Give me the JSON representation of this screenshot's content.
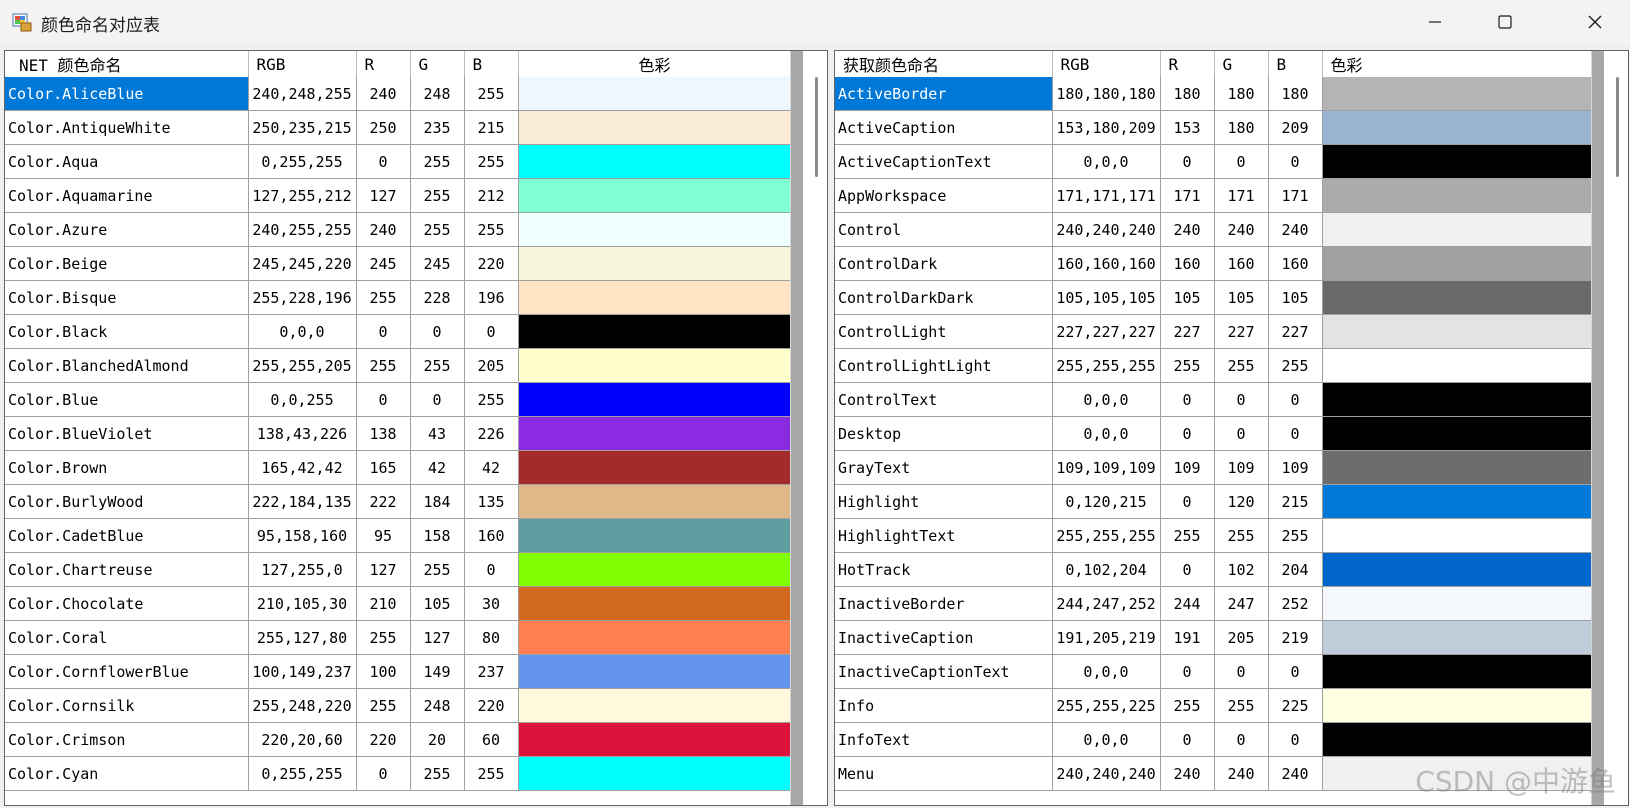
{
  "window": {
    "title": "颜色命名对应表",
    "watermark": "CSDN @中游鱼"
  },
  "left_grid": {
    "headers": [
      "NET 颜色命名",
      "RGB",
      "R",
      "G",
      "B",
      "色彩"
    ],
    "selected_row": 0,
    "rows": [
      {
        "name": "Color.AliceBlue",
        "rgb": "240,248,255",
        "r": "240",
        "g": "248",
        "b": "255",
        "color": "#f0f8ff"
      },
      {
        "name": "Color.AntiqueWhite",
        "rgb": "250,235,215",
        "r": "250",
        "g": "235",
        "b": "215",
        "color": "#faebd7"
      },
      {
        "name": "Color.Aqua",
        "rgb": "0,255,255",
        "r": "0",
        "g": "255",
        "b": "255",
        "color": "#00ffff"
      },
      {
        "name": "Color.Aquamarine",
        "rgb": "127,255,212",
        "r": "127",
        "g": "255",
        "b": "212",
        "color": "#7fffd4"
      },
      {
        "name": "Color.Azure",
        "rgb": "240,255,255",
        "r": "240",
        "g": "255",
        "b": "255",
        "color": "#f0ffff"
      },
      {
        "name": "Color.Beige",
        "rgb": "245,245,220",
        "r": "245",
        "g": "245",
        "b": "220",
        "color": "#f5f5dc"
      },
      {
        "name": "Color.Bisque",
        "rgb": "255,228,196",
        "r": "255",
        "g": "228",
        "b": "196",
        "color": "#ffe4c4"
      },
      {
        "name": "Color.Black",
        "rgb": "0,0,0",
        "r": "0",
        "g": "0",
        "b": "0",
        "color": "#000000"
      },
      {
        "name": "Color.BlanchedAlmond",
        "rgb": "255,255,205",
        "r": "255",
        "g": "255",
        "b": "205",
        "color": "#ffffcd"
      },
      {
        "name": "Color.Blue",
        "rgb": "0,0,255",
        "r": "0",
        "g": "0",
        "b": "255",
        "color": "#0000ff"
      },
      {
        "name": "Color.BlueViolet",
        "rgb": "138,43,226",
        "r": "138",
        "g": "43",
        "b": "226",
        "color": "#8a2be2"
      },
      {
        "name": "Color.Brown",
        "rgb": "165,42,42",
        "r": "165",
        "g": "42",
        "b": "42",
        "color": "#a52a2a"
      },
      {
        "name": "Color.BurlyWood",
        "rgb": "222,184,135",
        "r": "222",
        "g": "184",
        "b": "135",
        "color": "#deb887"
      },
      {
        "name": "Color.CadetBlue",
        "rgb": "95,158,160",
        "r": "95",
        "g": "158",
        "b": "160",
        "color": "#5f9ea0"
      },
      {
        "name": "Color.Chartreuse",
        "rgb": "127,255,0",
        "r": "127",
        "g": "255",
        "b": "0",
        "color": "#7fff00"
      },
      {
        "name": "Color.Chocolate",
        "rgb": "210,105,30",
        "r": "210",
        "g": "105",
        "b": "30",
        "color": "#d2691e"
      },
      {
        "name": "Color.Coral",
        "rgb": "255,127,80",
        "r": "255",
        "g": "127",
        "b": "80",
        "color": "#ff7f50"
      },
      {
        "name": "Color.CornflowerBlue",
        "rgb": "100,149,237",
        "r": "100",
        "g": "149",
        "b": "237",
        "color": "#6495ed"
      },
      {
        "name": "Color.Cornsilk",
        "rgb": "255,248,220",
        "r": "255",
        "g": "248",
        "b": "220",
        "color": "#fff8dc"
      },
      {
        "name": "Color.Crimson",
        "rgb": "220,20,60",
        "r": "220",
        "g": "20",
        "b": "60",
        "color": "#dc143c"
      },
      {
        "name": "Color.Cyan",
        "rgb": "0,255,255",
        "r": "0",
        "g": "255",
        "b": "255",
        "color": "#00ffff"
      }
    ]
  },
  "right_grid": {
    "headers": [
      "获取颜色命名",
      "RGB",
      "R",
      "G",
      "B",
      "色彩"
    ],
    "selected_row": 0,
    "rows": [
      {
        "name": "ActiveBorder",
        "rgb": "180,180,180",
        "r": "180",
        "g": "180",
        "b": "180",
        "color": "#b4b4b4"
      },
      {
        "name": "ActiveCaption",
        "rgb": "153,180,209",
        "r": "153",
        "g": "180",
        "b": "209",
        "color": "#99b4d1"
      },
      {
        "name": "ActiveCaptionText",
        "rgb": "0,0,0",
        "r": "0",
        "g": "0",
        "b": "0",
        "color": "#000000"
      },
      {
        "name": "AppWorkspace",
        "rgb": "171,171,171",
        "r": "171",
        "g": "171",
        "b": "171",
        "color": "#ababab"
      },
      {
        "name": "Control",
        "rgb": "240,240,240",
        "r": "240",
        "g": "240",
        "b": "240",
        "color": "#f0f0f0"
      },
      {
        "name": "ControlDark",
        "rgb": "160,160,160",
        "r": "160",
        "g": "160",
        "b": "160",
        "color": "#a0a0a0"
      },
      {
        "name": "ControlDarkDark",
        "rgb": "105,105,105",
        "r": "105",
        "g": "105",
        "b": "105",
        "color": "#696969"
      },
      {
        "name": "ControlLight",
        "rgb": "227,227,227",
        "r": "227",
        "g": "227",
        "b": "227",
        "color": "#e3e3e3"
      },
      {
        "name": "ControlLightLight",
        "rgb": "255,255,255",
        "r": "255",
        "g": "255",
        "b": "255",
        "color": "#ffffff"
      },
      {
        "name": "ControlText",
        "rgb": "0,0,0",
        "r": "0",
        "g": "0",
        "b": "0",
        "color": "#000000"
      },
      {
        "name": "Desktop",
        "rgb": "0,0,0",
        "r": "0",
        "g": "0",
        "b": "0",
        "color": "#000000"
      },
      {
        "name": "GrayText",
        "rgb": "109,109,109",
        "r": "109",
        "g": "109",
        "b": "109",
        "color": "#6d6d6d"
      },
      {
        "name": "Highlight",
        "rgb": "0,120,215",
        "r": "0",
        "g": "120",
        "b": "215",
        "color": "#0078d7"
      },
      {
        "name": "HighlightText",
        "rgb": "255,255,255",
        "r": "255",
        "g": "255",
        "b": "255",
        "color": "#ffffff"
      },
      {
        "name": "HotTrack",
        "rgb": "0,102,204",
        "r": "0",
        "g": "102",
        "b": "204",
        "color": "#0066cc"
      },
      {
        "name": "InactiveBorder",
        "rgb": "244,247,252",
        "r": "244",
        "g": "247",
        "b": "252",
        "color": "#f4f7fc"
      },
      {
        "name": "InactiveCaption",
        "rgb": "191,205,219",
        "r": "191",
        "g": "205",
        "b": "219",
        "color": "#bfcddb"
      },
      {
        "name": "InactiveCaptionText",
        "rgb": "0,0,0",
        "r": "0",
        "g": "0",
        "b": "0",
        "color": "#000000"
      },
      {
        "name": "Info",
        "rgb": "255,255,225",
        "r": "255",
        "g": "255",
        "b": "225",
        "color": "#ffffe1"
      },
      {
        "name": "InfoText",
        "rgb": "0,0,0",
        "r": "0",
        "g": "0",
        "b": "0",
        "color": "#000000"
      },
      {
        "name": "Menu",
        "rgb": "240,240,240",
        "r": "240",
        "g": "240",
        "b": "240",
        "color": "#f0f0f0"
      }
    ]
  }
}
